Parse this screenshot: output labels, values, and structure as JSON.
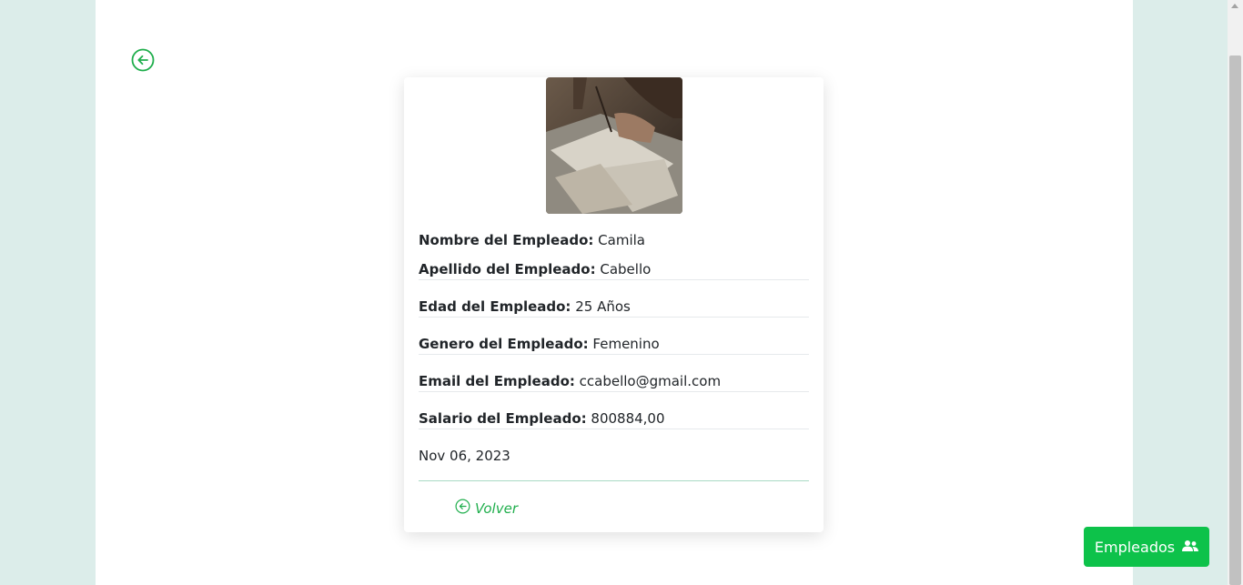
{
  "colors": {
    "background": "#dcedea",
    "accent": "#1fae4c",
    "button": "#0dc24a"
  },
  "nav": {
    "back_icon": "arrow-left-circle-icon"
  },
  "employee": {
    "photo": "employee-photo-writing-letter",
    "fields": [
      {
        "label": "Nombre del Empleado:",
        "value": "Camila"
      },
      {
        "label": "Apellido del Empleado:",
        "value": "Cabello"
      },
      {
        "label": "Edad del Empleado:",
        "value": "25 Años"
      },
      {
        "label": "Genero del Empleado:",
        "value": "Femenino"
      },
      {
        "label": "Email del Empleado:",
        "value": "ccabello@gmail.com"
      },
      {
        "label": "Salario del Empleado:",
        "value": "800884,00"
      }
    ],
    "date": "Nov 06, 2023"
  },
  "footer": {
    "volver_label": "Volver",
    "volver_icon": "arrow-left-circle-icon"
  },
  "fab": {
    "label": "Empleados",
    "icon": "users-icon"
  }
}
